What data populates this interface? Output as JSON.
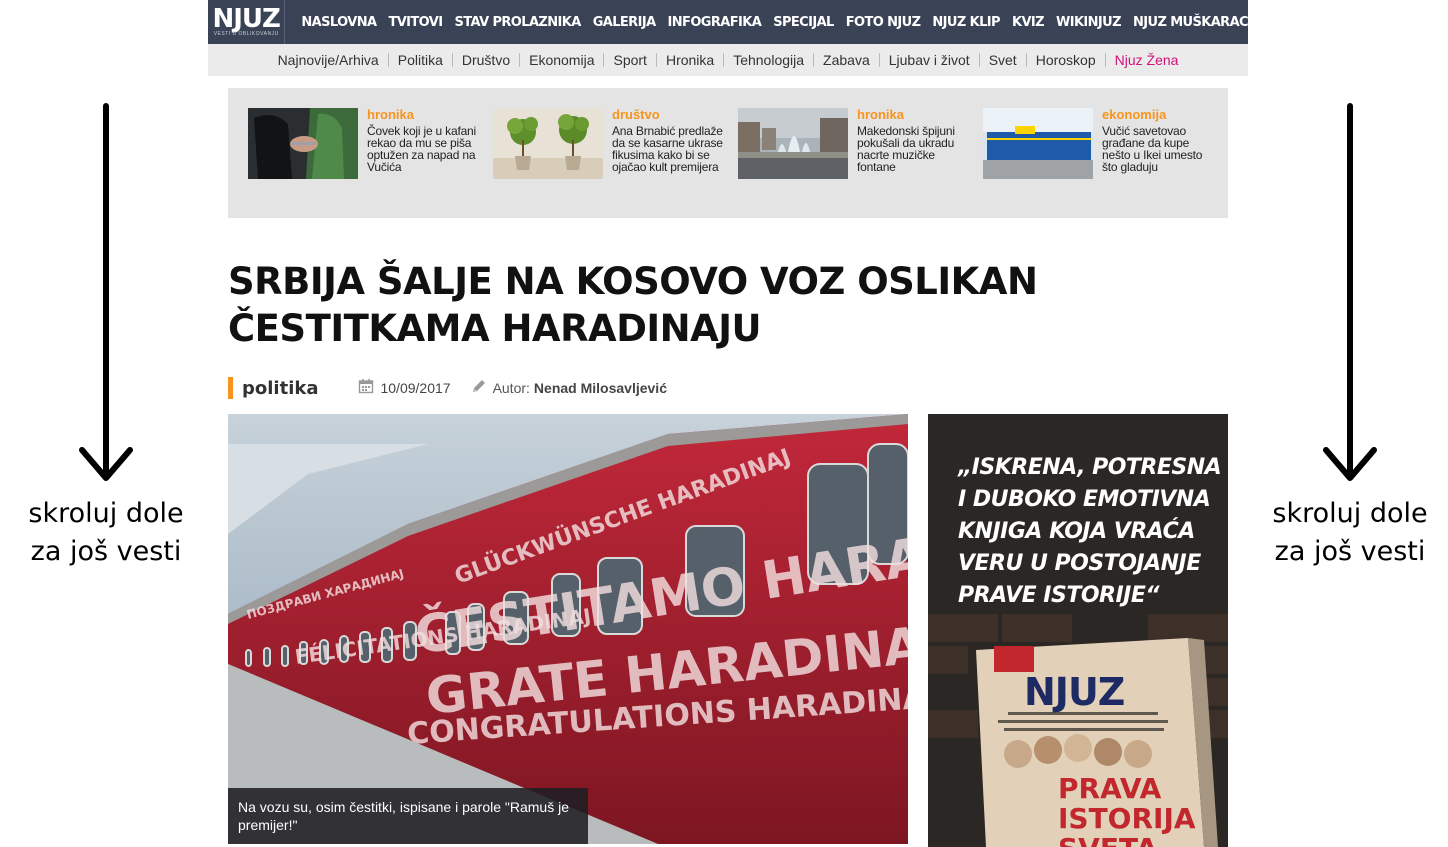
{
  "logo": {
    "text": "NJUZ",
    "tagline": "VESTI U OBLIKOVANJU"
  },
  "topnav": [
    "NASLOVNA",
    "TVITOVI",
    "STAV PROLAZNIKA",
    "GALERIJA",
    "INFOGRAFIKA",
    "SPECIJAL",
    "FOTO NJUZ",
    "NJUZ KLIP",
    "KVIZ",
    "WIKINJUZ",
    "NJUZ MUŠKARAC"
  ],
  "subnav": [
    "Najnovije/Arhiva",
    "Politika",
    "Društvo",
    "Ekonomija",
    "Sport",
    "Hronika",
    "Tehnologija",
    "Zabava",
    "Ljubav i život",
    "Svet",
    "Horoskop",
    "Njuz Žena"
  ],
  "teasers": [
    {
      "category": "hronika",
      "title": "Čovek koji je u kafani rekao da mu se piša optužen za napad na Vučića"
    },
    {
      "category": "društvo",
      "title": "Ana Brnabić predlaže da se kasarne ukrase fikusima kako bi se ojačao kult premijera"
    },
    {
      "category": "hronika",
      "title": "Makedonski špijuni pokušali da ukradu nacrte muzičke fontane"
    },
    {
      "category": "ekonomija",
      "title": "Vučić savetovao građane da kupe nešto u Ikei umesto što gladuju"
    }
  ],
  "article": {
    "title_line1": "SRBIJA ŠALJE NA KOSOVO VOZ OSLIKAN",
    "title_line2": "ČESTITKAMA HARADINAJU",
    "section": "politika",
    "date": "10/09/2017",
    "author_label": "Autor:",
    "author": "Nenad Milosavljević",
    "image_caption": "Na vozu su, osim čestitki, ispisane i parole \"Ramuš je premijer!\""
  },
  "train_text": {
    "line1": "GLÜCKWÜNSCHE HARADINAJ",
    "line2": "ČESTITAMO HARADINAJ",
    "line3": "ПОЗДРАВИ ХАРАДИНАЈ",
    "line4": "FÉLICITATIONS HARADINAJ",
    "line5": "GRATE HARADINAJ!",
    "line6": "CONGRATULATIONS HARADINAJ!"
  },
  "ad": {
    "quote": "„ISKRENA, POTRESNA I DUBOKO EMOTIVNA KNJIGA KOJA VRAĆA VERU U POSTOJANJE PRAVE ISTORIJE“",
    "book_brand": "NJUZ",
    "book_title_1": "PRAVA",
    "book_title_2": "ISTORIJA",
    "book_title_3": "SVETA"
  },
  "side_note": {
    "line1": "skroluj dole",
    "line2": "za još vesti"
  },
  "colors": {
    "topbar": "#3a4356",
    "accent": "#f7941d",
    "pink": "#d0127b"
  }
}
